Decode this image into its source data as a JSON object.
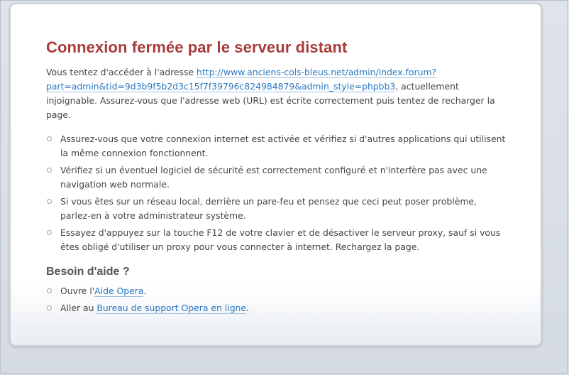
{
  "page": {
    "title": "Connexion fermée par le serveur distant",
    "intro": {
      "before_link": "Vous tentez d'accéder à l'adresse ",
      "url": "http://www.anciens-cols-bleus.net/admin/index.forum?part=admin&tid=9d3b9f5b2d3c15f7f39796c824984879&admin_style=phpbb3",
      "after_link": ", actuellement injoignable. Assurez-vous que l'adresse web (URL) est écrite correctement puis tentez de recharger la page."
    },
    "suggestions": [
      "Assurez-vous que votre connexion internet est activée et vérifiez si d'autres applications qui utilisent la même connexion fonctionnent.",
      "Vérifiez si un éventuel logiciel de sécurité est correctement configuré et n'interfère pas avec une navigation web normale.",
      "Si vous êtes sur un réseau local, derrière un pare-feu et pensez que ceci peut poser problème, parlez-en à votre administrateur système.",
      "Essayez d'appuyez sur la touche F12 de votre clavier et de désactiver le serveur proxy, sauf si vous êtes obligé d'utiliser un proxy pour vous connecter à internet. Rechargez la page."
    ],
    "help": {
      "title": "Besoin d'aide ?",
      "item1_before": "Ouvre l'",
      "item1_link": "Aide Opera",
      "item1_after": ".",
      "item2_before": "Aller au ",
      "item2_link": "Bureau de support Opera en ligne",
      "item2_after": "."
    }
  },
  "colors": {
    "title": "#a83c3c",
    "link": "#2a78c2",
    "text": "#444444",
    "background": "#dfe4ea"
  },
  "icons": {
    "bullet": "bullet-ring-icon"
  }
}
